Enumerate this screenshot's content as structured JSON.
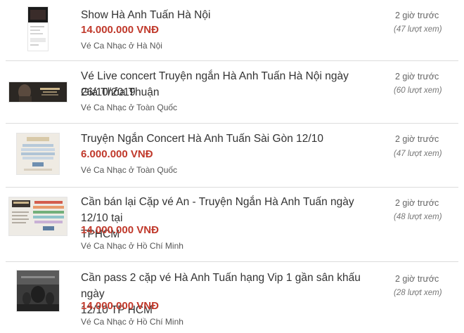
{
  "listings": [
    {
      "title_lines": [
        "Show Hà Anh Tuấn Hà Nội"
      ],
      "price": "14.000.000 VNĐ",
      "category": "Vé Ca Nhạc ở Hà Nội",
      "time": "2 giờ trước",
      "views": "(47 lượt xem)"
    },
    {
      "title_lines": [
        "Vé Live concert Truyện ngắn Hà Anh Tuấn Hà Nội ngày 26/10/2019"
      ],
      "price": "Giá Thỏa Thuận",
      "category": "Vé Ca Nhạc ở Toàn Quốc",
      "time": "2 giờ trước",
      "views": "(60 lượt xem)"
    },
    {
      "title_lines": [
        "Truyện Ngắn Concert Hà Anh Tuấn Sài Gòn 12/10"
      ],
      "price": "6.000.000 VNĐ",
      "category": "Vé Ca Nhạc ở Toàn Quốc",
      "time": "2 giờ trước",
      "views": "(47 lượt xem)"
    },
    {
      "title_lines": [
        "Cần bán lại Cặp vé An - Truyện Ngắn Hà Anh Tuấn ngày 12/10 tại",
        "TPHCM"
      ],
      "price": "14.000.000 VNĐ",
      "category": "Vé Ca Nhạc ở Hồ Chí Minh",
      "time": "2 giờ trước",
      "views": "(48 lượt xem)"
    },
    {
      "title_lines": [
        "Cần pass 2 cặp vé Hà Anh Tuấn hạng Vip 1 gần sân khấu ngày",
        "12/10 TP HCM"
      ],
      "price": "14.000.000 VNĐ",
      "category": "Vé Ca Nhạc ở Hồ Chí Minh",
      "time": "2 giờ trước",
      "views": "(28 lượt xem)"
    }
  ],
  "colors": {
    "price": "#c0392b",
    "divider": "#dcdcdc"
  }
}
